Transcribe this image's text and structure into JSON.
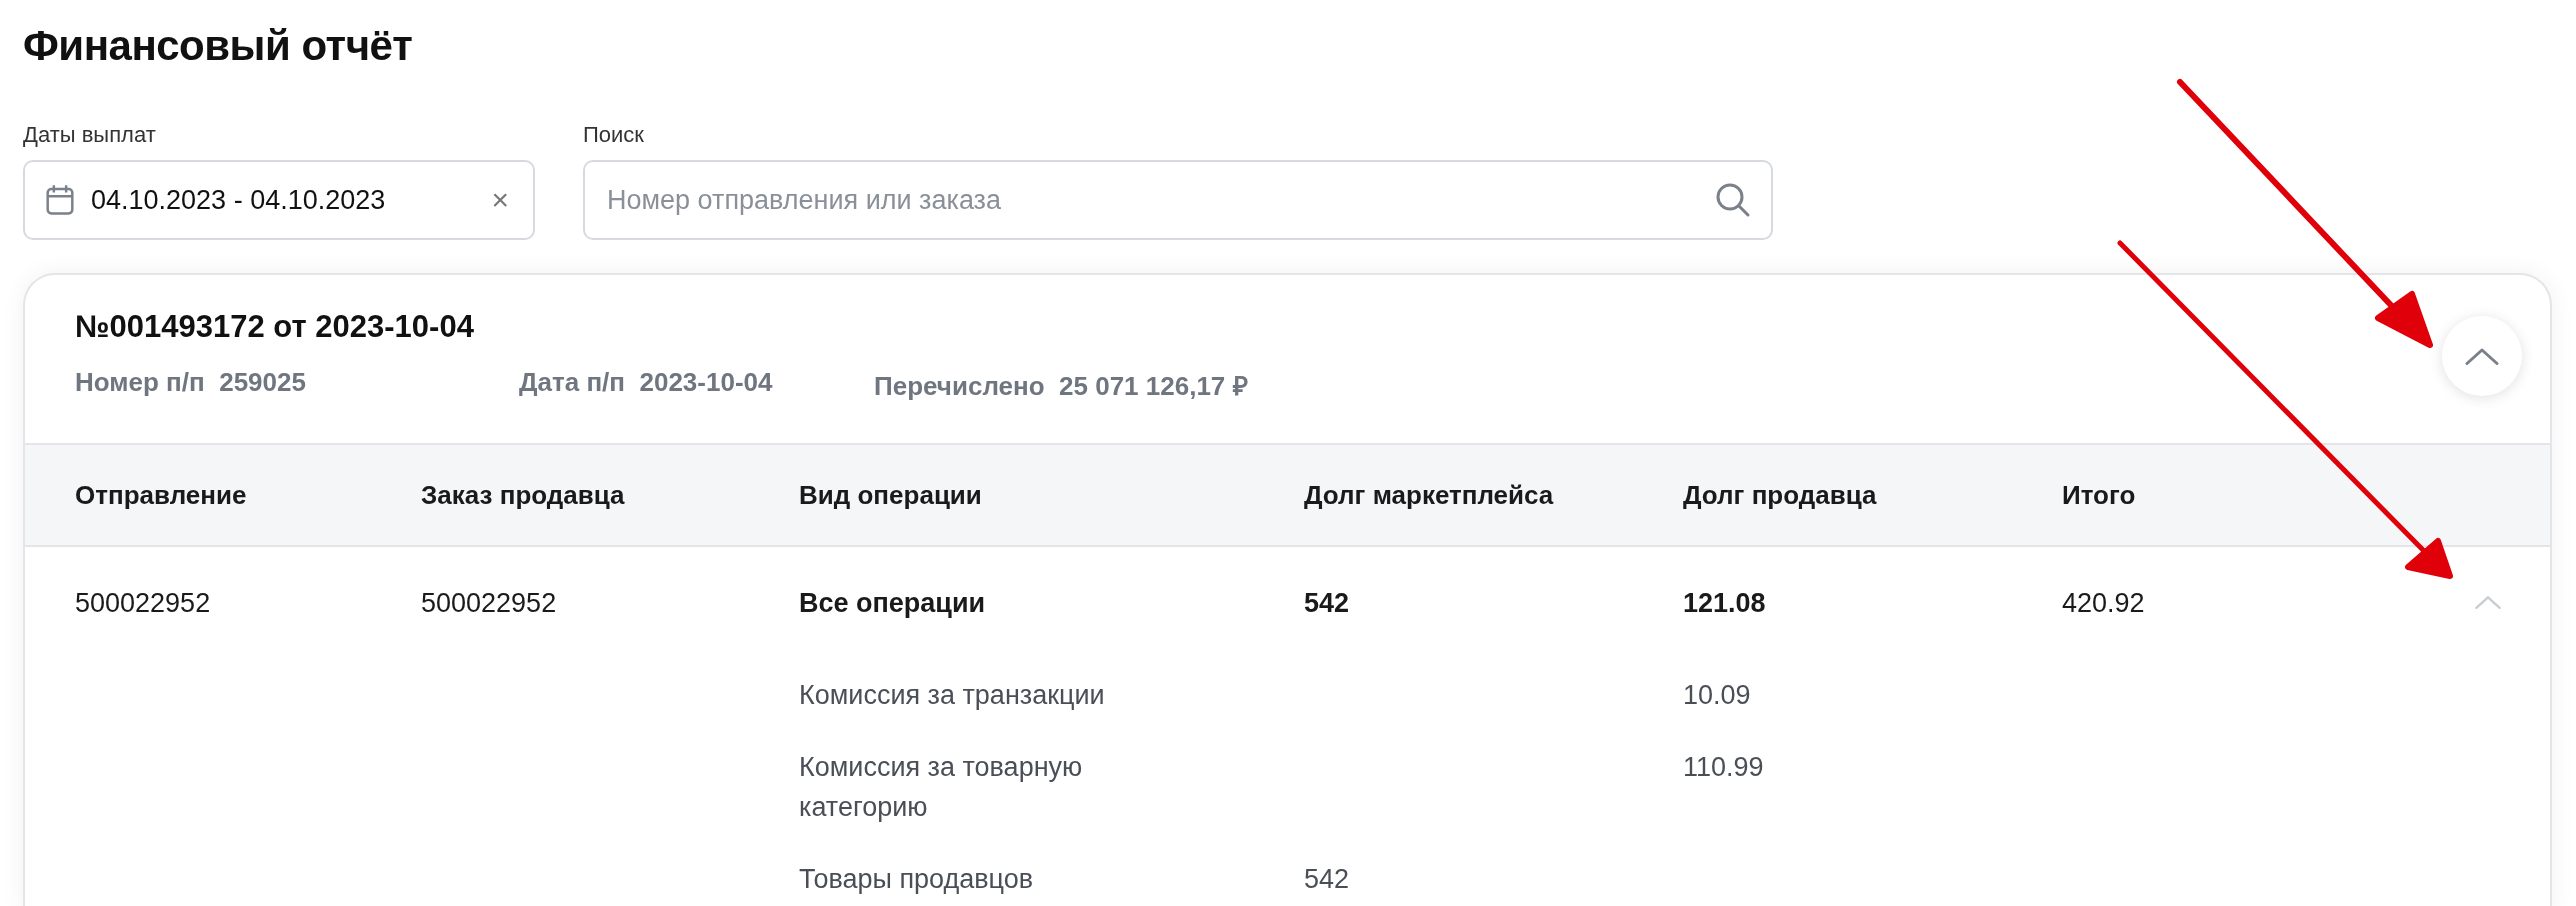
{
  "title": "Финансовый отчёт",
  "filters": {
    "dates": {
      "label": "Даты выплат",
      "value": "04.10.2023 - 04.10.2023",
      "clear": "×"
    },
    "search": {
      "label": "Поиск",
      "placeholder": "Номер отправления или заказа"
    }
  },
  "report": {
    "title": "№001493172 от 2023-10-04",
    "expanded": true,
    "meta": [
      {
        "label": "Номер п/п",
        "value": "259025"
      },
      {
        "label": "Дата п/п",
        "value": "2023-10-04"
      },
      {
        "label": "Перечислено",
        "value": "25 071 126,17 ₽"
      }
    ],
    "columns": [
      "Отправление",
      "Заказ продавца",
      "Вид операции",
      "Долг маркетплейса",
      "Долг продавца",
      "Итого"
    ],
    "rows": [
      {
        "shipment": "500022952",
        "seller_order": "500022952",
        "operation": "Все операции",
        "marketplace_debt": "542",
        "seller_debt": "121.08",
        "total": "420.92",
        "expanded": true,
        "operations": [
          {
            "name": "Комиссия за транзакции",
            "seller_debt": "10.09"
          },
          {
            "name": "Комиссия за товарную категорию",
            "seller_debt": "110.99"
          },
          {
            "name": "Товары продавцов",
            "marketplace_debt": "542"
          }
        ]
      }
    ]
  }
}
